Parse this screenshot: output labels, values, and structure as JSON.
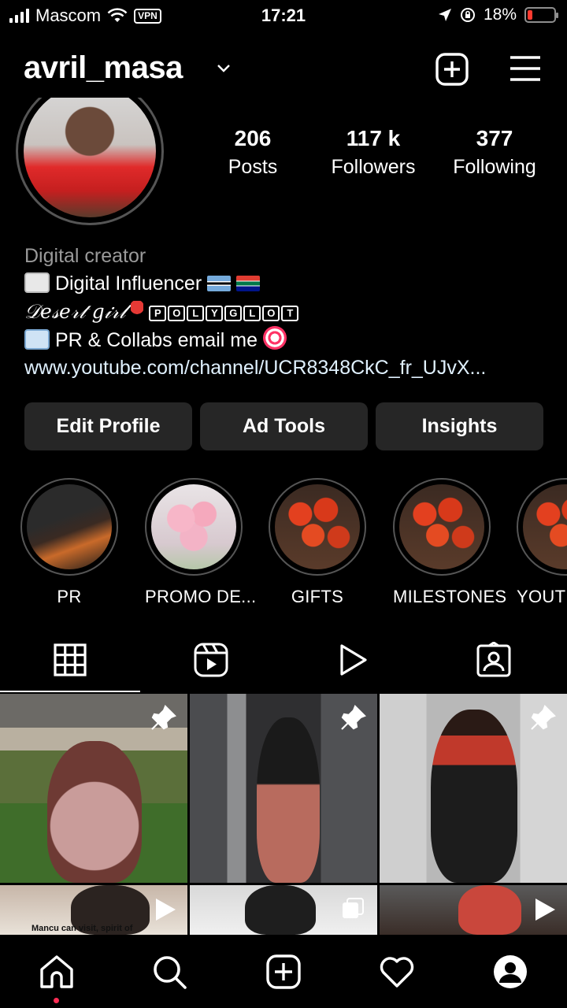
{
  "status_bar": {
    "carrier": "Mascom",
    "vpn": "VPN",
    "time": "17:21",
    "battery": "18%",
    "battery_level": 0.18
  },
  "header": {
    "username": "avril_masa"
  },
  "stats": {
    "posts_count": "206",
    "posts_label": "Posts",
    "followers_count": "117 k",
    "followers_label": "Followers",
    "following_count": "377",
    "following_label": "Following"
  },
  "bio": {
    "category": "Digital creator",
    "line1": "Digital Influencer",
    "line2_script": "𝒟𝑒𝓈𝑒𝓇𝓉 𝑔𝒾𝓇𝓁",
    "line2_boxed": [
      "P",
      "O",
      "L",
      "Y",
      "G",
      "L",
      "O",
      "T"
    ],
    "line3": "PR & Collabs email me",
    "link": "www.youtube.com/channel/UCR8348CkC_fr_UJvX..."
  },
  "actions": {
    "edit_profile": "Edit Profile",
    "ad_tools": "Ad Tools",
    "insights": "Insights"
  },
  "highlights": [
    {
      "label": "PR"
    },
    {
      "label": "PROMO DE..."
    },
    {
      "label": "GIFTS"
    },
    {
      "label": "MILESTONES"
    },
    {
      "label": "YOUT"
    }
  ],
  "grid": {
    "caption_partial": "Mancu can visit, spirit of"
  },
  "icons": {
    "chevron": "chevron-down-icon",
    "new_post": "plus-square-icon",
    "menu": "hamburger-menu-icon",
    "tab_grid": "grid-icon",
    "tab_reels": "reels-icon",
    "tab_videos": "play-icon",
    "tab_tagged": "tagged-user-icon",
    "nav_home": "home-icon",
    "nav_search": "search-icon",
    "nav_create": "plus-square-icon",
    "nav_activity": "heart-icon",
    "nav_profile": "profile-icon"
  },
  "colors": {
    "background": "#000000",
    "button_bg": "#262626",
    "muted_text": "#9a9a9a",
    "battery_low": "#ff3b30",
    "notification_dot": "#ff2d55"
  }
}
